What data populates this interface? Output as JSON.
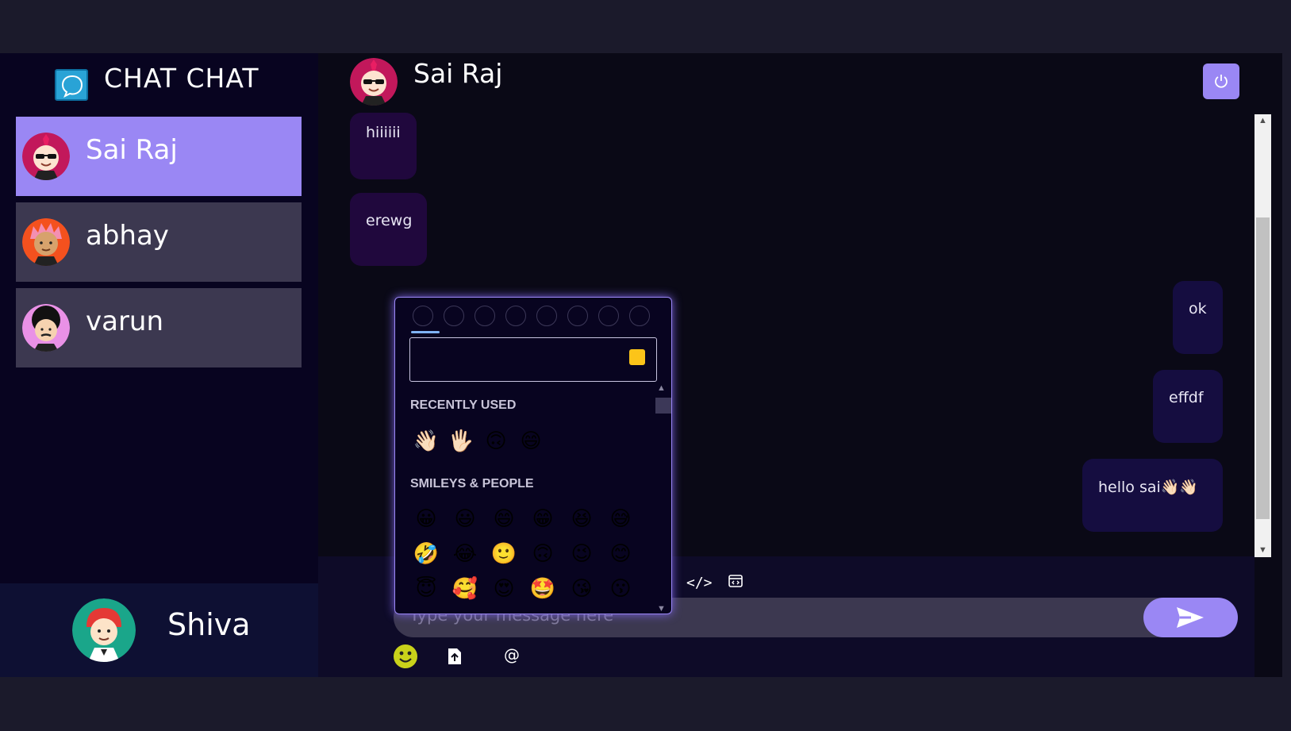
{
  "app": {
    "title": "CHAT CHAT"
  },
  "contacts": [
    {
      "name": "Sai Raj",
      "active": true
    },
    {
      "name": "abhay",
      "active": false
    },
    {
      "name": "varun",
      "active": false
    }
  ],
  "current_user": {
    "name": "Shiva"
  },
  "chat": {
    "contact_name": "Sai Raj",
    "messages": [
      {
        "text": "hiiiiii",
        "direction": "received"
      },
      {
        "text": "erewg",
        "direction": "received"
      },
      {
        "text": "ok",
        "direction": "sent"
      },
      {
        "text": "effdf",
        "direction": "sent"
      },
      {
        "text": "hello sai👋🏻👋🏻",
        "direction": "sent"
      }
    ],
    "input_placeholder": "Type your message here"
  },
  "emoji_picker": {
    "recent_title": "Recently Used",
    "recent": [
      "👋🏻",
      "🖐🏻",
      "🙃",
      "😄"
    ],
    "smileys_title": "Smileys & People",
    "smileys": [
      "😀",
      "😃",
      "😄",
      "😁",
      "😆",
      "😅",
      "🤣",
      "😂",
      "🙂",
      "🙃",
      "😉",
      "😊",
      "😇",
      "🥰",
      "😍",
      "🤩",
      "😘",
      "😗"
    ]
  },
  "colors": {
    "accent": "#9a87f4",
    "background": "#0a0916",
    "sidebar": "#080420"
  },
  "icons": {
    "logo": "chat-bubble-icon",
    "logout": "power-icon",
    "send": "send-arrow-icon",
    "code": "code-icon",
    "embed": "embed-icon",
    "emoji": "smiley-icon",
    "file": "file-upload-icon",
    "mention": "at-icon"
  }
}
